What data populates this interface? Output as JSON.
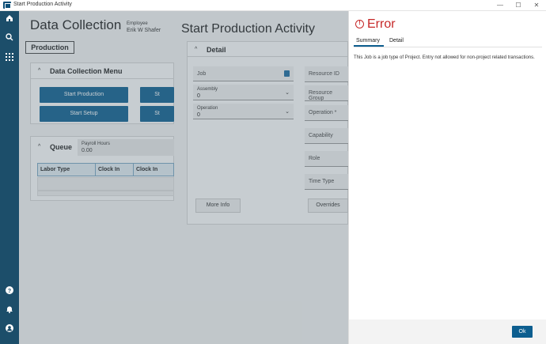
{
  "window": {
    "title": "Start Production Activity",
    "minimize": "—",
    "maximize": "☐",
    "close": "✕"
  },
  "sidebar": {
    "top_icons": [
      "home-icon",
      "search-icon",
      "apps-icon"
    ],
    "bottom_icons": [
      "help-icon",
      "bell-icon",
      "user-icon"
    ]
  },
  "data_collection": {
    "title": "Data Collection",
    "employee_label": "Employee",
    "employee_name": "Erik W Shafer",
    "tab": "Production",
    "menu": {
      "title": "Data Collection Menu",
      "buttons": [
        "Start Production",
        "St",
        "Start Setup",
        "St"
      ]
    },
    "queue": {
      "title": "Queue",
      "payroll_label": "Payroll Hours",
      "payroll_value": "0.00",
      "columns": [
        "Labor Type",
        "Clock In Date",
        "Clock In"
      ]
    }
  },
  "start_production": {
    "title": "Start Production Activity",
    "detail_title": "Detail",
    "job_label": "Job",
    "assembly_label": "Assembly",
    "assembly_value": "0",
    "operation_label": "Operation",
    "operation_value": "0",
    "right_fields": [
      "Resource ID",
      "Resource Group",
      "Operation *",
      "Capability",
      "Role",
      "Time Type"
    ],
    "more_info": "More Info",
    "overrides": "Overrides"
  },
  "error": {
    "title": "Error",
    "icon": "!",
    "tabs": [
      "Summary",
      "Detail"
    ],
    "message": "This Job is a job type of Project. Entry not allowed for non-project related transactions.",
    "ok": "Ok"
  },
  "colors": {
    "accent": "#0d5e8f",
    "sidebar": "#1c4e6a",
    "error": "#c62828"
  }
}
